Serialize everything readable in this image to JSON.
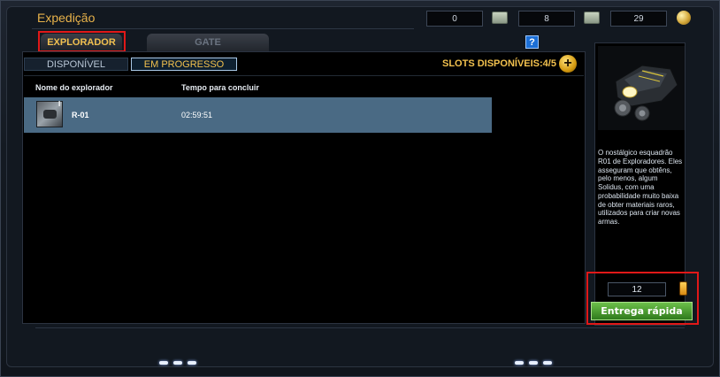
{
  "window": {
    "title": "Expedição"
  },
  "currency": {
    "value1": "0",
    "value2": "8",
    "value3": "29"
  },
  "tabs": {
    "explorador": "EXPLORADOR",
    "gate": "GATE"
  },
  "help_label": "?",
  "subtabs": {
    "disponivel": "DISPONÍVEL",
    "em_progresso": "EM PROGRESSO"
  },
  "slots": {
    "label": "SLOTS DISPONÍVEIS:4/5",
    "add_label": "+"
  },
  "table": {
    "headers": [
      "Nome do explorador",
      "Tempo para concluir"
    ],
    "rows": [
      {
        "roman": "I",
        "name": "R-01",
        "time": "02:59:51"
      }
    ]
  },
  "side": {
    "description": "O nostálgico esquadrão R01 de Exploradores. Eles asseguram que obtêns, pelo menos, algum Solidus, com uma probabilidade muito baixa de obter materiais raros, utilizados para criar novas armas.",
    "quantity": "12",
    "deliver_label": "Entrega rápida"
  },
  "colors": {
    "accent": "#f2c14e",
    "highlight": "#e01818",
    "row_bg": "#4a6a84",
    "button": "#2f7a1c"
  },
  "icons": [
    "ticket-icon",
    "coin-icon",
    "help-icon",
    "add-icon",
    "explorer-vehicle-icon",
    "fuel-icon"
  ]
}
